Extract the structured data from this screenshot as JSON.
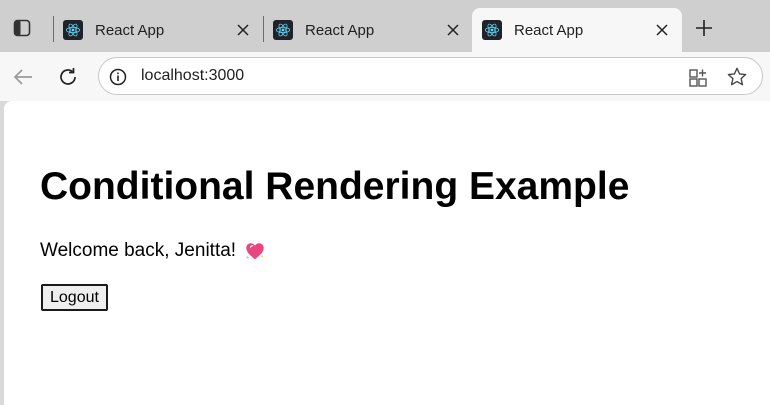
{
  "browser": {
    "tabs": [
      {
        "title": "React App",
        "active": false
      },
      {
        "title": "React App",
        "active": false
      },
      {
        "title": "React App",
        "active": true
      }
    ],
    "address_bar": {
      "url": "localhost:3000"
    },
    "icons": {
      "tab_actions": "tab-actions-icon",
      "favicon": "react-logo-icon",
      "close": "close-icon",
      "new_tab": "plus-icon",
      "back": "back-arrow-icon",
      "reload": "reload-icon",
      "site_info": "info-icon",
      "apps": "apps-icon",
      "favorite": "star-icon"
    }
  },
  "page": {
    "heading": "Conditional Rendering Example",
    "welcome_text": "Welcome back, Jenitta!",
    "welcome_emoji": "sparkling-heart-icon",
    "logout_label": "Logout"
  },
  "colors": {
    "react_cyan": "#61dafb",
    "favicon_bg": "#20232a",
    "heart_pink": "#e8467c"
  }
}
